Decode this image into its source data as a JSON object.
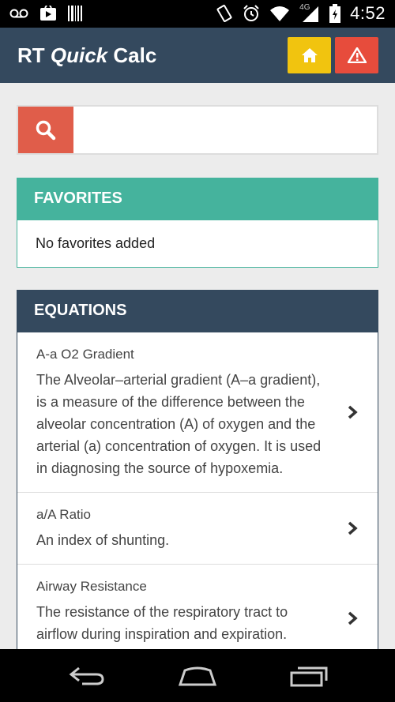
{
  "status_bar": {
    "time": "4:52",
    "network": "4G",
    "left_icons": [
      "voicemail-icon",
      "play-store-icon",
      "barcode-icon"
    ],
    "right_icons": [
      "vibrate-icon",
      "alarm-icon",
      "wifi-icon",
      "signal-icon",
      "battery-icon"
    ]
  },
  "app_bar": {
    "title_part1": "RT ",
    "title_part2": "Quick",
    "title_part3": " Calc",
    "home_icon": "home-icon",
    "alert_icon": "warning-icon",
    "colors": {
      "bar": "#34495e",
      "home": "#f1c40f",
      "alert": "#e74c3c"
    }
  },
  "search": {
    "placeholder": "",
    "value": "",
    "icon": "search-icon",
    "color": "#e05d4a"
  },
  "favorites": {
    "header": "FAVORITES",
    "empty_text": "No favorites added",
    "color": "#45b39d"
  },
  "equations": {
    "header": "EQUATIONS",
    "items": [
      {
        "title": "A-a O2 Gradient",
        "description": "The Alveolar–arterial gradient (A–a gradient), is a measure of the difference between the alveolar concentration (A) of oxygen and the arterial (a) concentration of oxygen. It is used in diagnosing the source of hypoxemia."
      },
      {
        "title": "a/A Ratio",
        "description": "An index of shunting."
      },
      {
        "title": "Airway Resistance",
        "description": "The resistance of the respiratory tract to airflow during inspiration and expiration."
      }
    ]
  },
  "nav_bar": {
    "buttons": [
      "back-icon",
      "home-nav-icon",
      "recents-icon"
    ]
  }
}
